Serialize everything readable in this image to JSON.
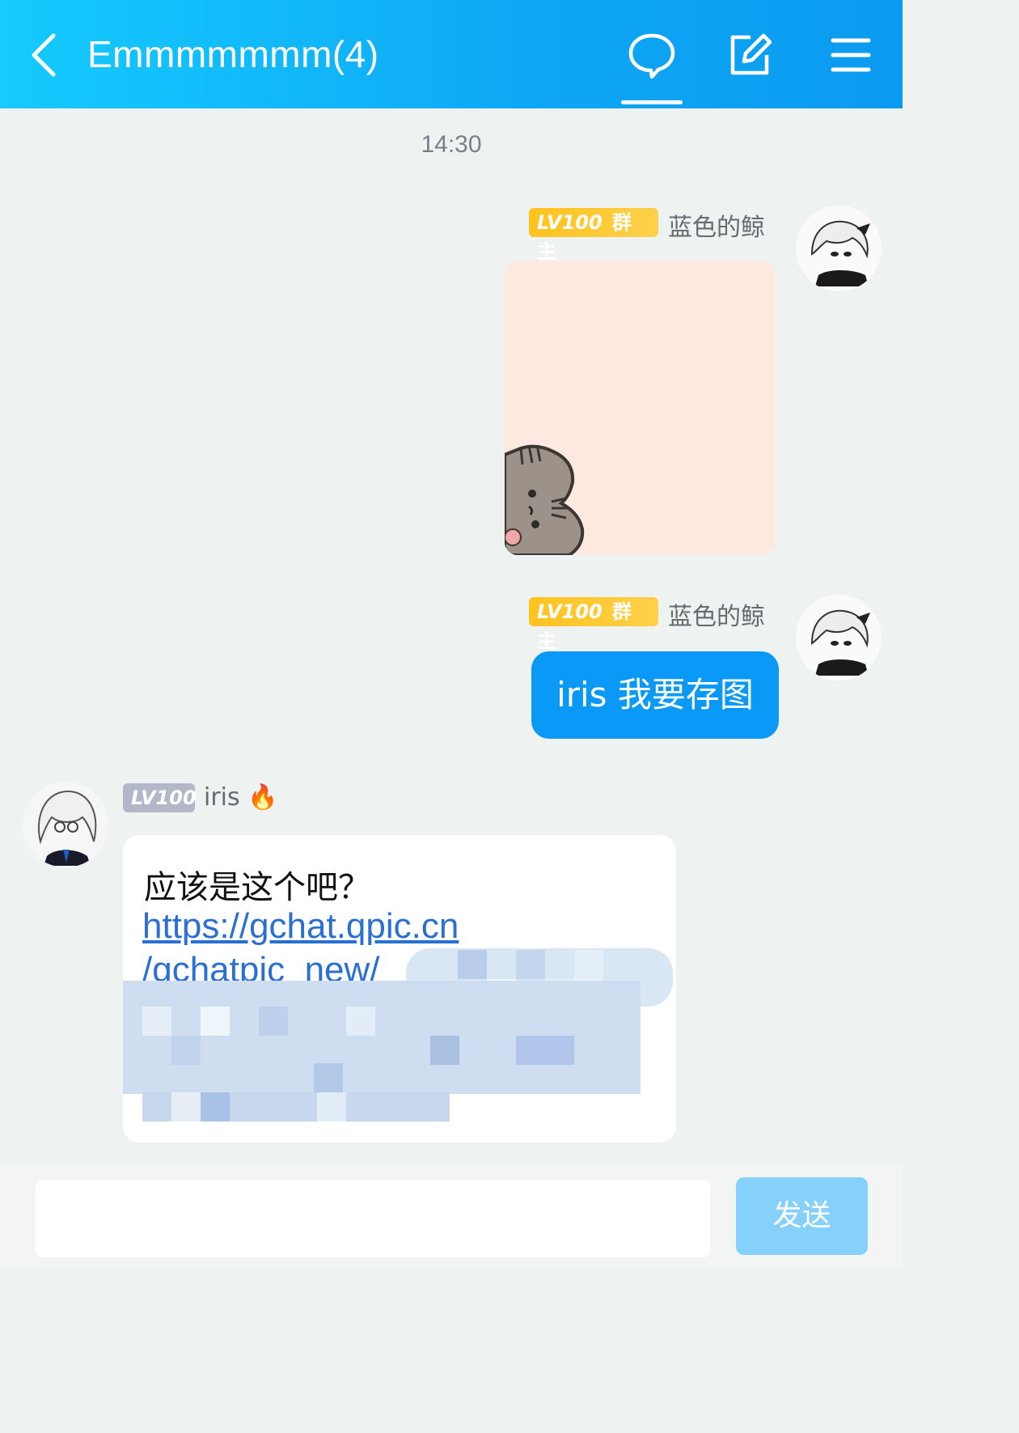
{
  "header": {
    "title": "Emmmmmmm(4)",
    "icons": [
      "back-chevron-icon",
      "chat-bubble-icon",
      "edit-icon",
      "menu-icon"
    ],
    "accent_color": "#0ea7f4"
  },
  "chat": {
    "timestamp": "14:30",
    "messages": [
      {
        "level": "LV100",
        "role": "群主",
        "sender": "蓝色的鲸",
        "type": "image"
      },
      {
        "level": "LV100",
        "role": "群主",
        "sender": "蓝色的鲸",
        "type": "text",
        "text": "iris 我要存图"
      },
      {
        "level": "LV100",
        "sender": "iris",
        "sender_emoji": "🔥",
        "type": "text",
        "text": "应该是这个吧？",
        "link_line1": "https://gchat.qpic.cn",
        "link_line2": "/gchatpic_new/"
      }
    ]
  },
  "composer": {
    "input_value": "",
    "send_label": "发送"
  }
}
